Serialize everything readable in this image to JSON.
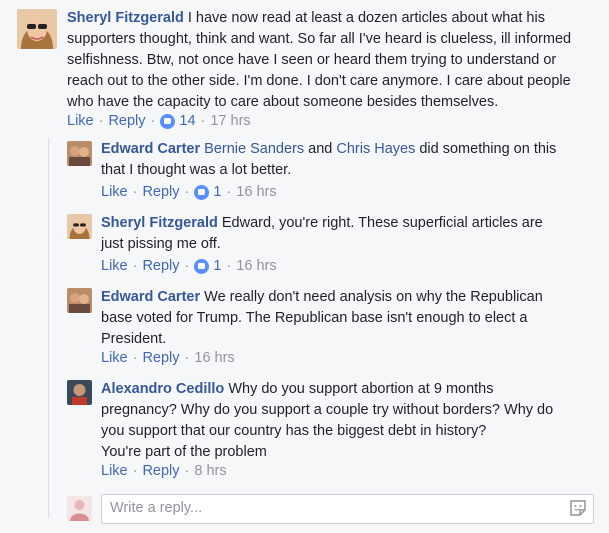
{
  "comments": [
    {
      "author": "Sheryl Fitzgerald",
      "lines": [
        "I have now read at least a dozen articles about what his",
        "supporters thought, think and want. So far all I've heard is clueless, ill informed",
        "selfishness. Btw, not once have I seen or heard them trying to understand or",
        "reach out to the other side. I'm done. I don't care anymore. I care about people",
        "who have the capacity to care about someone besides themselves."
      ],
      "like": "Like",
      "reply": "Reply",
      "likes": "14",
      "time": "17 hrs"
    },
    {
      "author": "Edward Carter",
      "mention1": "Bernie Sanders",
      "and": " and ",
      "mention2": "Chris Hayes",
      "line1_rest": " did something on this",
      "line2": "that I thought was a lot better.",
      "like": "Like",
      "reply": "Reply",
      "likes": "1",
      "time": "16 hrs"
    },
    {
      "author": "Sheryl Fitzgerald",
      "line1": "Edward, you're right. These superficial articles are",
      "line2": "just pissing me off.",
      "like": "Like",
      "reply": "Reply",
      "likes": "1",
      "time": "16 hrs"
    },
    {
      "author": "Edward Carter",
      "line1": "We really don't need analysis on why the Republican",
      "line2": "base voted for Trump. The Republican base isn't enough to elect a",
      "line3": "President.",
      "like": "Like",
      "reply": "Reply",
      "time": "16 hrs"
    },
    {
      "author": "Alexandro Cedillo",
      "line1": "Why do you support abortion at 9 months",
      "line2": "pregnancy? Why do you support a couple try without borders? Why do",
      "line3": "you support that our country has the biggest debt in history?",
      "line4": "You're part of the problem",
      "like": "Like",
      "reply": "Reply",
      "time": "8 hrs"
    }
  ],
  "reply_box": {
    "placeholder": "Write a reply..."
  },
  "separator": "·",
  "icons": {
    "like_badge": "thumbs-up-icon",
    "sticker": "sticker-icon"
  },
  "colors": {
    "link": "#365899",
    "action": "#4267b2",
    "meta": "#90949c",
    "like_badge": "#5890ff"
  }
}
